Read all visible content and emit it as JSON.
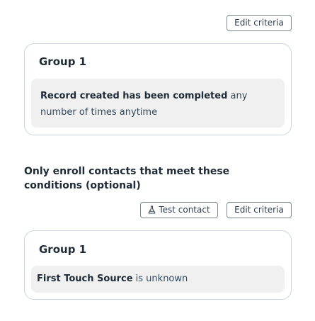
{
  "enrollment": {
    "edit_criteria_label": "Edit criteria",
    "group": {
      "title": "Group 1",
      "criterion": {
        "property": "Record created has been completed",
        "condition": " any number of times anytime"
      }
    }
  },
  "filters": {
    "heading": "Only enroll contacts that meet these conditions (optional)",
    "test_contact_label": "Test contact",
    "test_contact_icon": "flask-icon",
    "edit_criteria_label": "Edit criteria",
    "group": {
      "title": "Group 1",
      "criterion": {
        "property": "First Touch Source",
        "condition": " is unknown"
      }
    }
  },
  "colors": {
    "border": "#cbd6e2",
    "button_border": "#7c8790",
    "criteria_bg": "#f0f0f0",
    "text": "#33475b",
    "heading_text": "#1f2b36"
  }
}
